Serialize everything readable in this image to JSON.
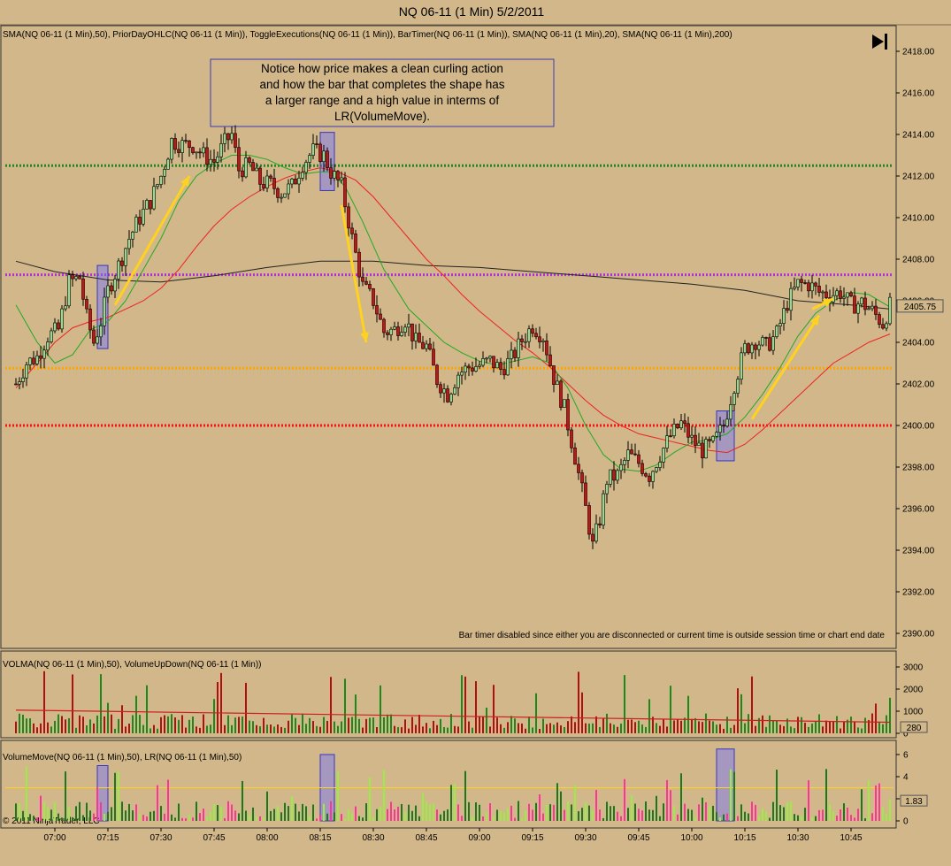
{
  "window": {
    "title": "NQ 06-11 (1 Min)  5/2/2011",
    "copyright": "© 2011 NinjaTrader, LLC"
  },
  "toolbar": {
    "play_to_end_icon": "skip-to-end-icon"
  },
  "price_panel": {
    "indicators_label": "SMA(NQ 06-11 (1 Min),50), PriorDayOHLC(NQ 06-11 (1 Min)), ToggleExecutions(NQ 06-11 (1 Min)), BarTimer(NQ 06-11 (1 Min)), SMA(NQ 06-11 (1 Min),20), SMA(NQ 06-11 (1 Min),200)",
    "annotation_lines": [
      "Notice how price makes a clean curling action",
      "and how the bar that completes the shape has",
      "a larger range and a high value in interms of",
      "LR(VolumeMove)."
    ],
    "bar_timer_message": "Bar timer disabled since either you are disconnected or current time is outside session time or chart end date",
    "last_price_label": "2405.75",
    "y_ticks": [
      "2390.00",
      "2392.00",
      "2394.00",
      "2396.00",
      "2398.00",
      "2400.00",
      "2402.00",
      "2404.00",
      "2406.00",
      "2408.00",
      "2410.00",
      "2412.00",
      "2414.00",
      "2416.00",
      "2418.00"
    ]
  },
  "volume_panel": {
    "indicators_label": "VOLMA(NQ 06-11 (1 Min),50), VolumeUpDown(NQ 06-11 (1 Min))",
    "y_ticks": [
      "0",
      "1000",
      "2000",
      "3000"
    ],
    "last_value_label": "280"
  },
  "volumemove_panel": {
    "indicators_label": "VolumeMove(NQ 06-11 (1 Min),50), LR(NQ 06-11 (1 Min),50)",
    "y_ticks": [
      "0",
      "2",
      "4",
      "6"
    ],
    "last_value_label": "1.83"
  },
  "x_axis": {
    "ticks": [
      "07:00",
      "07:15",
      "07:30",
      "07:45",
      "08:00",
      "08:15",
      "08:30",
      "08:45",
      "09:00",
      "09:15",
      "09:30",
      "09:45",
      "10:00",
      "10:15",
      "10:30",
      "10:45"
    ]
  },
  "colors": {
    "background": "#d1b78a",
    "up_candle": "#9bd98f",
    "down_candle": "#cc1111",
    "sma20": "#22aa22",
    "sma50": "#ee2222",
    "sma200": "#222222",
    "prior_high": "#228822",
    "prior_close": "#b030e0",
    "prior_open": "#ffa500",
    "prior_low": "#ff1010",
    "arrow": "#ffd21f",
    "highlight": "#7070ff"
  },
  "chart_data": {
    "type": "candlestick",
    "title": "NQ 06-11 (1 Min)  5/2/2011",
    "xlabel": "",
    "ylabel": "",
    "ylim": [
      2389.5,
      2419
    ],
    "prior_day_levels": {
      "high": 2412.5,
      "close": 2407.25,
      "open": 2402.75,
      "low": 2400.0
    },
    "price_path": [
      [
        "06:49",
        2402.0
      ],
      [
        "06:52",
        2403.0
      ],
      [
        "06:55",
        2403.3
      ],
      [
        "06:58",
        2404.3
      ],
      [
        "07:01",
        2404.6
      ],
      [
        "07:04",
        2406.9
      ],
      [
        "07:07",
        2407.1
      ],
      [
        "07:09",
        2405.2
      ],
      [
        "07:11",
        2404.0
      ],
      [
        "07:13",
        2405.0
      ],
      [
        "07:15",
        2406.5
      ],
      [
        "07:18",
        2407.7
      ],
      [
        "07:21",
        2409.0
      ],
      [
        "07:24",
        2410.0
      ],
      [
        "07:27",
        2410.8
      ],
      [
        "07:30",
        2412.0
      ],
      [
        "07:33",
        2413.7
      ],
      [
        "07:36",
        2413.5
      ],
      [
        "07:39",
        2413.5
      ],
      [
        "07:42",
        2413.0
      ],
      [
        "07:45",
        2412.7
      ],
      [
        "07:48",
        2413.6
      ],
      [
        "07:50",
        2414.0
      ],
      [
        "07:52",
        2412.3
      ],
      [
        "07:55",
        2412.5
      ],
      [
        "07:58",
        2411.7
      ],
      [
        "08:01",
        2411.6
      ],
      [
        "08:04",
        2411.2
      ],
      [
        "08:07",
        2411.5
      ],
      [
        "08:10",
        2412.6
      ],
      [
        "08:13",
        2413.2
      ],
      [
        "08:16",
        2413.0
      ],
      [
        "08:18",
        2412.2
      ],
      [
        "08:21",
        2411.5
      ],
      [
        "08:24",
        2409.0
      ],
      [
        "08:27",
        2406.7
      ],
      [
        "08:30",
        2406.0
      ],
      [
        "08:33",
        2404.5
      ],
      [
        "08:36",
        2404.6
      ],
      [
        "08:39",
        2405.1
      ],
      [
        "08:42",
        2404.0
      ],
      [
        "08:45",
        2403.8
      ],
      [
        "08:48",
        2402.2
      ],
      [
        "08:51",
        2401.5
      ],
      [
        "08:54",
        2402.5
      ],
      [
        "08:57",
        2402.8
      ],
      [
        "09:00",
        2402.9
      ],
      [
        "09:03",
        2403.1
      ],
      [
        "09:06",
        2402.7
      ],
      [
        "09:09",
        2403.2
      ],
      [
        "09:12",
        2404.1
      ],
      [
        "09:15",
        2404.8
      ],
      [
        "09:18",
        2404.3
      ],
      [
        "09:21",
        2402.3
      ],
      [
        "09:24",
        2400.8
      ],
      [
        "09:27",
        2398.5
      ],
      [
        "09:30",
        2396.0
      ],
      [
        "09:32",
        2394.2
      ],
      [
        "09:34",
        2395.5
      ],
      [
        "09:36",
        2397.4
      ],
      [
        "09:39",
        2397.6
      ],
      [
        "09:42",
        2398.6
      ],
      [
        "09:45",
        2398.2
      ],
      [
        "09:48",
        2397.6
      ],
      [
        "09:51",
        2398.6
      ],
      [
        "09:54",
        2399.5
      ],
      [
        "09:57",
        2400.1
      ],
      [
        "10:00",
        2399.3
      ],
      [
        "10:03",
        2398.8
      ],
      [
        "10:06",
        2399.1
      ],
      [
        "10:09",
        2400.0
      ],
      [
        "10:12",
        2402.0
      ],
      [
        "10:15",
        2403.7
      ],
      [
        "10:18",
        2404.1
      ],
      [
        "10:21",
        2403.8
      ],
      [
        "10:24",
        2404.4
      ],
      [
        "10:27",
        2405.9
      ],
      [
        "10:30",
        2406.8
      ],
      [
        "10:33",
        2406.8
      ],
      [
        "10:36",
        2406.4
      ],
      [
        "10:39",
        2406.3
      ],
      [
        "10:42",
        2406.4
      ],
      [
        "10:45",
        2405.8
      ],
      [
        "10:48",
        2405.9
      ],
      [
        "10:51",
        2405.5
      ],
      [
        "10:54",
        2404.9
      ],
      [
        "10:56",
        2405.75
      ]
    ],
    "sma20": [
      [
        "06:49",
        2405.8
      ],
      [
        "06:55",
        2404.0
      ],
      [
        "07:00",
        2403.0
      ],
      [
        "07:05",
        2403.4
      ],
      [
        "07:10",
        2404.6
      ],
      [
        "07:15",
        2405.0
      ],
      [
        "07:20",
        2406.0
      ],
      [
        "07:25",
        2407.5
      ],
      [
        "07:30",
        2409.0
      ],
      [
        "07:35",
        2410.8
      ],
      [
        "07:40",
        2412.0
      ],
      [
        "07:45",
        2412.6
      ],
      [
        "07:50",
        2413.0
      ],
      [
        "07:55",
        2413.0
      ],
      [
        "08:00",
        2412.8
      ],
      [
        "08:05",
        2412.4
      ],
      [
        "08:10",
        2412.1
      ],
      [
        "08:15",
        2412.2
      ],
      [
        "08:18",
        2412.2
      ],
      [
        "08:22",
        2411.5
      ],
      [
        "08:27",
        2409.8
      ],
      [
        "08:33",
        2407.5
      ],
      [
        "08:40",
        2405.6
      ],
      [
        "08:45",
        2404.8
      ],
      [
        "08:50",
        2404.0
      ],
      [
        "08:55",
        2403.5
      ],
      [
        "09:00",
        2403.1
      ],
      [
        "09:05",
        2402.9
      ],
      [
        "09:10",
        2403.1
      ],
      [
        "09:15",
        2403.3
      ],
      [
        "09:20",
        2403.0
      ],
      [
        "09:25",
        2401.8
      ],
      [
        "09:30",
        2400.0
      ],
      [
        "09:35",
        2398.6
      ],
      [
        "09:40",
        2397.9
      ],
      [
        "09:45",
        2397.8
      ],
      [
        "09:50",
        2398.1
      ],
      [
        "09:55",
        2398.7
      ],
      [
        "10:00",
        2399.2
      ],
      [
        "10:05",
        2399.3
      ],
      [
        "10:10",
        2399.6
      ],
      [
        "10:15",
        2400.4
      ],
      [
        "10:20",
        2401.5
      ],
      [
        "10:25",
        2402.8
      ],
      [
        "10:30",
        2404.3
      ],
      [
        "10:35",
        2405.4
      ],
      [
        "10:40",
        2406.0
      ],
      [
        "10:45",
        2406.4
      ],
      [
        "10:50",
        2406.3
      ],
      [
        "10:56",
        2405.7
      ]
    ],
    "sma50": [
      [
        "06:49",
        2401.8
      ],
      [
        "07:00",
        2404.0
      ],
      [
        "07:05",
        2404.7
      ],
      [
        "07:10",
        2405.0
      ],
      [
        "07:15",
        2405.2
      ],
      [
        "07:20",
        2405.6
      ],
      [
        "07:25",
        2406.0
      ],
      [
        "07:30",
        2406.6
      ],
      [
        "07:35",
        2407.5
      ],
      [
        "07:40",
        2408.6
      ],
      [
        "07:45",
        2409.6
      ],
      [
        "07:50",
        2410.4
      ],
      [
        "07:55",
        2411.0
      ],
      [
        "08:00",
        2411.5
      ],
      [
        "08:05",
        2411.9
      ],
      [
        "08:10",
        2412.2
      ],
      [
        "08:15",
        2412.4
      ],
      [
        "08:20",
        2412.2
      ],
      [
        "08:25",
        2411.8
      ],
      [
        "08:30",
        2411.0
      ],
      [
        "08:35",
        2410.0
      ],
      [
        "08:40",
        2409.0
      ],
      [
        "08:45",
        2408.0
      ],
      [
        "08:50",
        2407.2
      ],
      [
        "08:55",
        2406.3
      ],
      [
        "09:00",
        2405.5
      ],
      [
        "09:05",
        2404.8
      ],
      [
        "09:10",
        2404.1
      ],
      [
        "09:15",
        2403.5
      ],
      [
        "09:20",
        2402.8
      ],
      [
        "09:25",
        2402.0
      ],
      [
        "09:30",
        2401.2
      ],
      [
        "09:35",
        2400.5
      ],
      [
        "09:40",
        2400.0
      ],
      [
        "09:45",
        2399.6
      ],
      [
        "09:50",
        2399.4
      ],
      [
        "09:55",
        2399.2
      ],
      [
        "10:00",
        2399.0
      ],
      [
        "10:05",
        2398.8
      ],
      [
        "10:10",
        2398.7
      ],
      [
        "10:15",
        2399.1
      ],
      [
        "10:20",
        2399.8
      ],
      [
        "10:25",
        2400.6
      ],
      [
        "10:30",
        2401.4
      ],
      [
        "10:35",
        2402.2
      ],
      [
        "10:40",
        2403.0
      ],
      [
        "10:45",
        2403.5
      ],
      [
        "10:50",
        2404.0
      ],
      [
        "10:56",
        2404.4
      ]
    ],
    "sma200": [
      [
        "06:49",
        2407.9
      ],
      [
        "07:00",
        2407.4
      ],
      [
        "07:15",
        2407.0
      ],
      [
        "07:30",
        2406.9
      ],
      [
        "07:45",
        2407.2
      ],
      [
        "08:00",
        2407.6
      ],
      [
        "08:15",
        2407.9
      ],
      [
        "08:30",
        2407.9
      ],
      [
        "08:45",
        2407.7
      ],
      [
        "09:00",
        2407.6
      ],
      [
        "09:15",
        2407.4
      ],
      [
        "09:30",
        2407.2
      ],
      [
        "09:45",
        2407.0
      ],
      [
        "10:00",
        2406.8
      ],
      [
        "10:15",
        2406.5
      ],
      [
        "10:30",
        2406.0
      ],
      [
        "10:45",
        2405.8
      ],
      [
        "10:56",
        2405.6
      ]
    ],
    "annotations": {
      "arrows": [
        {
          "from": [
            "07:17",
            2405.8
          ],
          "to": [
            "07:38",
            2412.0
          ]
        },
        {
          "from": [
            "08:21",
            2410.6
          ],
          "to": [
            "08:28",
            2404.0
          ]
        },
        {
          "from": [
            "10:17",
            2400.3
          ],
          "to": [
            "10:36",
            2405.3
          ]
        },
        {
          "from": [
            "10:34",
            2405.6
          ],
          "to": [
            "10:40",
            2406.1
          ]
        }
      ],
      "highlight_boxes": [
        {
          "x": [
            "07:12",
            "07:15"
          ],
          "y": [
            2403.7,
            2407.7
          ]
        },
        {
          "x": [
            "08:15",
            "08:19"
          ],
          "y": [
            2411.3,
            2414.1
          ]
        },
        {
          "x": [
            "10:07",
            "10:12"
          ],
          "y": [
            2398.3,
            2400.7
          ]
        }
      ]
    },
    "volume": {
      "max_reference": 3000,
      "vol_ma_start": 1050,
      "vol_ma_end": 500,
      "last": 280
    },
    "volumemove": {
      "level_line": 3,
      "last": 1.83,
      "highlight_boxes": [
        {
          "x": [
            "07:12",
            "07:15"
          ],
          "y": [
            0,
            5
          ]
        },
        {
          "x": [
            "08:15",
            "08:19"
          ],
          "y": [
            0,
            6
          ]
        },
        {
          "x": [
            "10:07",
            "10:12"
          ],
          "y": [
            0,
            6.5
          ]
        }
      ]
    }
  }
}
